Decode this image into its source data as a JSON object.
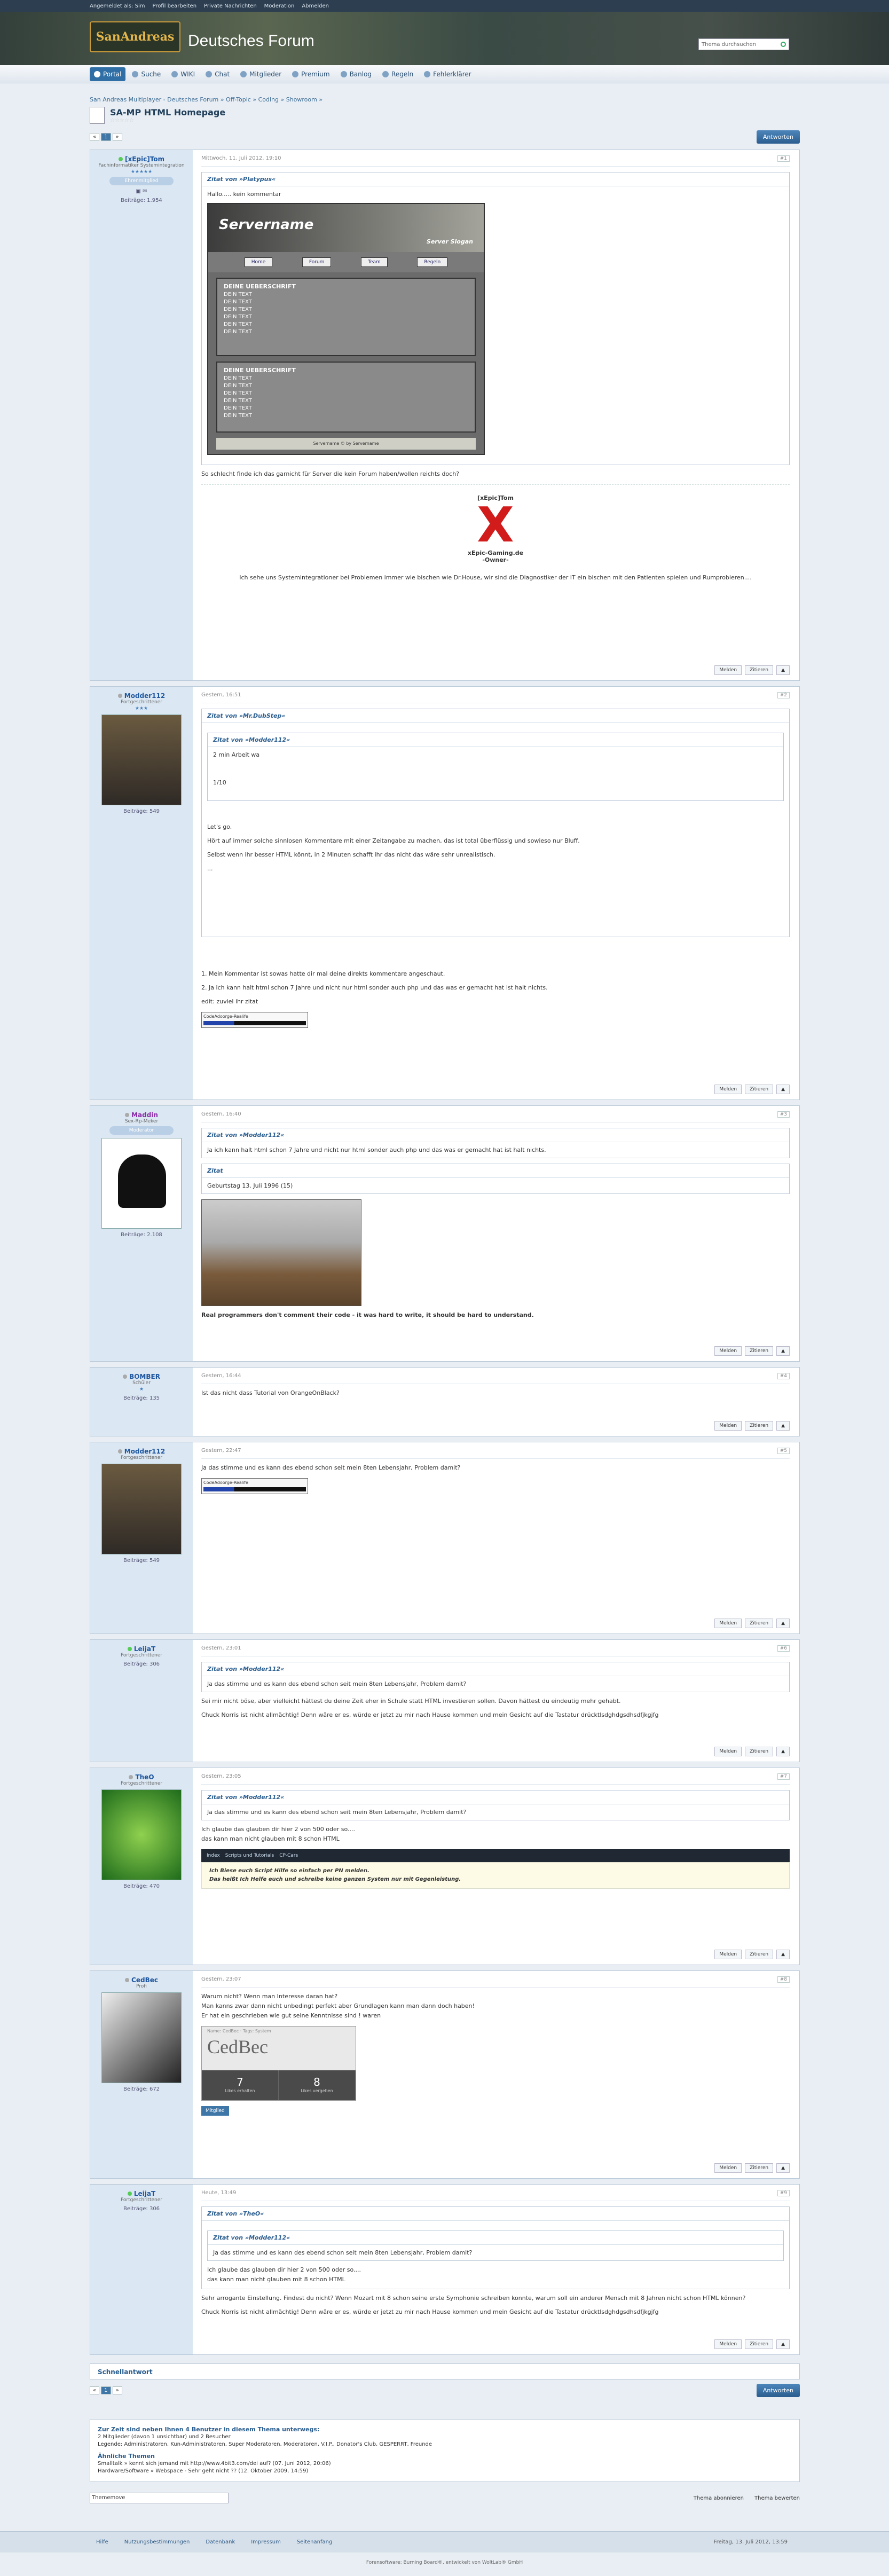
{
  "topbar": {
    "login": "Angemeldet als: Sim",
    "profile": "Profil bearbeiten",
    "messages": "Private Nachrichten",
    "moderation": "Moderation",
    "logout": "Abmelden"
  },
  "header": {
    "logo_text": "SanAndreas",
    "site_title": "Deutsches Forum",
    "search_placeholder": "Thema durchsuchen"
  },
  "nav": [
    "Portal",
    "Suche",
    "WIKI",
    "Chat",
    "Mitglieder",
    "Premium",
    "Banlog",
    "Regeln",
    "Fehlerklärer"
  ],
  "breadcrumb": "San Andreas Multiplayer - Deutsches Forum » Off-Topic » Coding » Showroom »",
  "thread": {
    "title": "SA-MP HTML Homepage",
    "rating": "☆☆☆☆☆",
    "pages": [
      "«",
      "1",
      "»"
    ],
    "reply_button": "Antworten"
  },
  "posts": [
    {
      "user": "[xEpic]Tom",
      "rank": "Fachinformatiker Systemintegration",
      "badge": "Ehrenmitglied",
      "posts_label": "Beiträge: 1.954",
      "date": "Mittwoch, 11. Juli 2012, 19:10",
      "num": "#1",
      "quote_author": "Zitat von »Platypus«",
      "quote_text": "Hallo..... kein kommentar",
      "mock": {
        "title": "Servername",
        "slogan": "Server Slogan",
        "nav": [
          "Home",
          "Forum",
          "Team",
          "Regeln"
        ],
        "box_title": "DEINE UEBERSCHRIFT",
        "box_line": "DEIN TEXT",
        "footer": "Servername © by Servername"
      },
      "text": "So schlecht finde ich das garnicht für Server die kein Forum haben/wollen reichts doch?",
      "sig_name": "[xEpic]Tom",
      "sig_site": "xEpic-Gaming.de",
      "sig_sub": "-Owner-",
      "sig_text": "Ich sehe uns Systemintegrationer bei Problemen immer wie bischen wie Dr.House, wir sind die Diagnostiker der IT ein bischen mit den Patienten spielen und Rumprobieren...."
    },
    {
      "user": "Modder112",
      "rank": "Fortgeschrittener",
      "posts_label": "Beiträge: 549",
      "date": "Gestern, 16:51",
      "num": "#2",
      "quote_author": "Zitat von »Mr.DubStep«",
      "inner_author": "Zitat von »Modder112«",
      "inner_text": "2 min Arbeit wa",
      "inner_count": "1/10",
      "q_lines": [
        "Let's go.",
        "Hört auf immer solche sinnlosen Kommentare mit einer Zeitangabe zu machen, das ist total überflüssig und sowieso nur Bluff.",
        "Selbst wenn ihr besser HTML könnt, in 2 Minuten schafft ihr das nicht das wäre sehr unrealistisch.",
        "..."
      ],
      "lines": [
        "1. Mein Kommentar ist sowas hatte dir mal deine direkts kommentare angeschaut.",
        "2. Ja ich kann halt html schon 7 Jahre und nicht nur html sonder auch php und das was er gemacht hat ist halt nichts.",
        "edit: zuviel ihr zitat"
      ],
      "codebar": "CodeAdoorge-Realife"
    },
    {
      "user": "Maddin",
      "rank": "Sex-Rp-Meker",
      "badge": "Moderator",
      "posts_label": "Beiträge: 2.108",
      "date": "Gestern, 16:40",
      "num": "#3",
      "quote_author": "Zitat von »Modder112«",
      "quote_text": "Ja ich kann halt html schon 7 Jahre und nicht nur html sonder auch php und das was er gemacht hat ist halt nichts.",
      "quote2_author": "Zitat",
      "quote2_text": "Geburtstag 13. Juli 1996 (15)",
      "text": "Real programmers don't comment their code - it was hard to write, it should be hard to understand."
    },
    {
      "user": "BOMBER",
      "rank": "Schüler",
      "posts_label": "Beiträge: 135",
      "date": "Gestern, 16:44",
      "num": "#4",
      "text": "Ist das nicht dass Tutorial von OrangeOnBlack?"
    },
    {
      "user": "Modder112",
      "rank": "Fortgeschrittener",
      "posts_label": "Beiträge: 549",
      "date": "Gestern, 22:47",
      "num": "#5",
      "text": "Ja das stimme und es kann des ebend schon seit mein 8ten Lebensjahr, Problem damit?",
      "codebar": "CodeAdoorge-Realife"
    },
    {
      "user": "LeijaT",
      "rank": "Fortgeschrittener",
      "posts_label": "Beiträge: 306",
      "date": "Gestern, 23:01",
      "num": "#6",
      "quote_author": "Zitat von »Modder112«",
      "quote_text": "Ja das stimme und es kann des ebend schon seit mein 8ten Lebensjahr, Problem damit?",
      "lines": [
        "Sei mir nicht böse, aber vielleicht hättest du deine Zeit eher in Schule statt HTML investieren sollen. Davon hättest du eindeutig mehr gehabt.",
        "Chuck Norris ist nicht allmächtig! Denn wäre er es, würde er jetzt zu mir nach Hause kommen und mein Gesicht auf die Tastatur drücktlsdghdgsdhsdfjkgjfg"
      ]
    },
    {
      "user": "TheO",
      "rank": "Fortgeschrittener",
      "posts_label": "Beiträge: 470",
      "date": "Gestern, 23:05",
      "num": "#7",
      "quote_author": "Zitat von »Modder112«",
      "quote_text": "Ja das stimme und es kann des ebend schon seit mein 8ten Lebensjahr, Problem damit?",
      "lines": [
        "Ich glaube das glauben dir hier 2 von 500 oder so....",
        "das kann man nicht glauben mit 8 schon HTML"
      ],
      "bar_items": [
        "Index",
        "Scripts und Tutorials",
        "CP-Cars"
      ],
      "warn": [
        "Ich Biese euch Script Hilfe so einfach per PN melden.",
        "Das heißt Ich Helfe euch und schreibe keine ganzen System nur mit Gegenleistung."
      ]
    },
    {
      "user": "CedBec",
      "rank": "Profi",
      "posts_label": "Beiträge: 672",
      "date": "Gestern, 23:07",
      "num": "#8",
      "lines": [
        "Warum nicht? Wenn man Interesse daran hat?",
        "Man kanns zwar dann nicht unbedingt perfekt aber Grundlagen kann man dann doch haben!",
        "Er hat ein geschrieben wie gut seine Kenntnisse sind ! waren"
      ],
      "card": {
        "header": "Name: CedBec · Tags: System",
        "name": "CedBec",
        "received": "7",
        "received_label": "Likes erhalten",
        "given": "8",
        "given_label": "Likes vergeben"
      },
      "btn": "Mitglied"
    },
    {
      "user": "LeijaT",
      "rank": "Fortgeschrittener",
      "posts_label": "Beiträge: 306",
      "date": "Heute, 13:49",
      "num": "#9",
      "quote_author": "Zitat von »TheO«",
      "inner_author": "Zitat von »Modder112«",
      "inner_text": "Ja das stimme und es kann des ebend schon seit mein 8ten Lebensjahr, Problem damit?",
      "q_lines": [
        "Ich glaube das glauben dir hier 2 von 500 oder so....",
        "das kann man nicht glauben mit 8 schon HTML"
      ],
      "lines": [
        "Sehr arrogante Einstellung. Findest du nicht? Wenn Mozart mit 8 schon seine erste Symphonie schreiben konnte, warum soll ein anderer Mensch mit 8 Jahren nicht schon HTML können?",
        "Chuck Norris ist nicht allmächtig! Denn wäre er es, würde er jetzt zu mir nach Hause kommen und mein Gesicht auf die Tastatur drücktlsdghdgsdhsdfjkgjfg"
      ]
    }
  ],
  "post_buttons": {
    "report": "Melden",
    "quote": "Zitieren"
  },
  "quickreply": "Schnellantwort",
  "online": {
    "title": "Zur Zeit sind neben Ihnen 4 Benutzer in diesem Thema unterwegs:",
    "sub": "2 Mitglieder (davon 1 unsichtbar) und 2 Besucher",
    "legend": "Legende: Administratoren, Kun-Administratoren, Super Moderatoren, Moderatoren, V.I.P., Donator's Club, GESPERRT, Freunde",
    "similar": "Ähnliche Themen",
    "sim1": "Smalltalk » kennt sich jemand mit http://www.4bit3.com/dei auf? (07. Juni 2012, 20:06)",
    "sim2": "Hardware/Software » Webspace - Sehr geht nicht ?? (12. Oktober 2009, 14:59)"
  },
  "bottom": {
    "select": "Thememove",
    "subscribe": "Thema abonnieren",
    "bewerten": "Thema bewerten"
  },
  "footer": {
    "items": [
      "Hilfe",
      "Nutzungsbestimmungen",
      "Datenbank",
      "Impressum"
    ],
    "top": "Seitenanfang",
    "date": "Freitag, 13. Juli 2012, 13:59"
  },
  "copyright": "Forensoftware: Burning Board®, entwickelt von WoltLab® GmbH"
}
